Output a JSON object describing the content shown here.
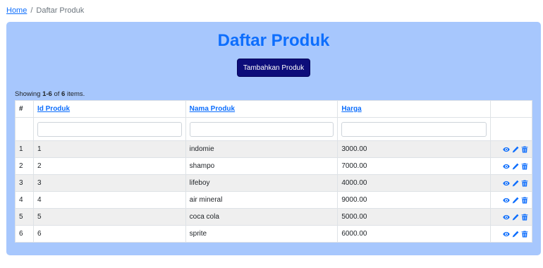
{
  "breadcrumb": {
    "home": "Home",
    "separator": "/",
    "current": "Daftar Produk"
  },
  "page": {
    "title": "Daftar Produk",
    "add_button": "Tambahkan Produk"
  },
  "summary": {
    "prefix": "Showing ",
    "range": "1-6",
    "of": " of ",
    "total": "6",
    "suffix": " items."
  },
  "table": {
    "headers": {
      "no": "#",
      "id": "Id Produk",
      "name": "Nama Produk",
      "price": "Harga"
    },
    "rows": [
      {
        "no": "1",
        "id": "1",
        "name": "indomie",
        "price": "3000.00"
      },
      {
        "no": "2",
        "id": "2",
        "name": "shampo",
        "price": "7000.00"
      },
      {
        "no": "3",
        "id": "3",
        "name": "lifeboy",
        "price": "4000.00"
      },
      {
        "no": "4",
        "id": "4",
        "name": "air mineral",
        "price": "9000.00"
      },
      {
        "no": "5",
        "id": "5",
        "name": "coca cola",
        "price": "5000.00"
      },
      {
        "no": "6",
        "id": "6",
        "name": "sprite",
        "price": "6000.00"
      }
    ],
    "row_actions": [
      "eye-icon",
      "pencil-icon",
      "trash-icon"
    ]
  },
  "colors": {
    "accent": "#0d6efd",
    "card_bg": "#a7c7fd",
    "button_bg": "#0d0d7a"
  }
}
